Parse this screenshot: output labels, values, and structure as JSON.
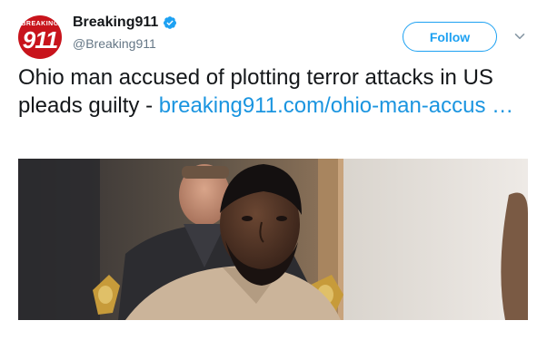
{
  "account": {
    "avatar_text_top": "BREAKING",
    "avatar_text_main": "911",
    "display_name": "Breaking911",
    "handle": "@Breaking911",
    "verified": true
  },
  "actions": {
    "follow_label": "Follow"
  },
  "tweet": {
    "text": "Ohio man accused of plotting terror attacks in US pleads guilty - ",
    "link_text": "breaking911.com/ohio-man-accus …"
  },
  "colors": {
    "accent": "#1da1f2",
    "link": "#1b95e0",
    "brand_red": "#c8141c",
    "text": "#14171a",
    "muted": "#657786"
  },
  "icons": {
    "verified": "verified-badge-icon",
    "caret": "chevron-down-icon"
  }
}
